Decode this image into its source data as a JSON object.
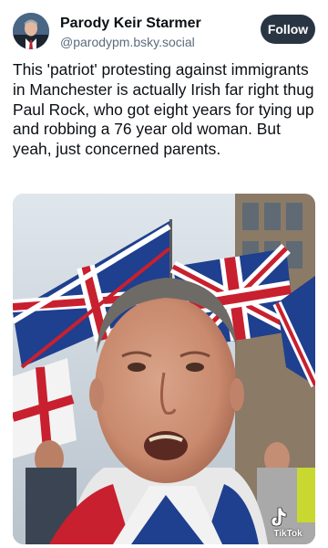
{
  "author": {
    "display_name": "Parody Keir Starmer",
    "handle": "@parodypm.bsky.social"
  },
  "follow_label": "Follow",
  "post": {
    "text": "This 'patriot' protesting against immigrants in Manchester is actually Irish far right thug Paul Rock, who got eight years for tying up and robbing a 76 year old woman. But yeah, just concerned parents."
  },
  "media": {
    "watermark": "TikTok"
  },
  "colors": {
    "follow_bg": "#2a3544",
    "handle_text": "#5b6b7e",
    "flag_blue": "#1f3f8f",
    "flag_red": "#c8202f"
  },
  "icons": {
    "avatar": "avatar-photo",
    "watermark": "tiktok-logo-icon"
  }
}
